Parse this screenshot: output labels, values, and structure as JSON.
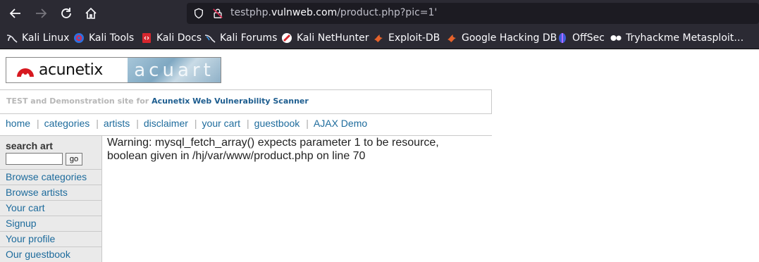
{
  "browser": {
    "url_prefix": "testphp.",
    "url_host": "vulnweb.com",
    "url_path": "/product.php?pic=1'"
  },
  "bookmarks": [
    {
      "label": "Kali Linux",
      "icon": "kali-linux-icon"
    },
    {
      "label": "Kali Tools",
      "icon": "kali-tools-icon"
    },
    {
      "label": "Kali Docs",
      "icon": "kali-docs-icon"
    },
    {
      "label": "Kali Forums",
      "icon": "kali-forums-icon"
    },
    {
      "label": "Kali NetHunter",
      "icon": "kali-nethunter-icon"
    },
    {
      "label": "Exploit-DB",
      "icon": "exploit-db-icon"
    },
    {
      "label": "Google Hacking DB",
      "icon": "google-hacking-db-icon"
    },
    {
      "label": "OffSec",
      "icon": "offsec-icon"
    },
    {
      "label": "Tryhackme Metasploit…",
      "icon": "tryhackme-icon"
    }
  ],
  "site": {
    "logo_left": "acunetix",
    "logo_right": "acuart",
    "tagline_prefix": "TEST and Demonstration site for",
    "tagline_link": "Acunetix Web Vulnerability Scanner"
  },
  "menu": [
    "home",
    "categories",
    "artists",
    "disclaimer",
    "your cart",
    "guestbook",
    "AJAX Demo"
  ],
  "sidebar": {
    "search_title": "search art",
    "search_value": "",
    "go_label": "go",
    "links": [
      "Browse categories",
      "Browse artists",
      "Your cart",
      "Signup",
      "Your profile",
      "Our guestbook"
    ]
  },
  "main": {
    "warning": "Warning: mysql_fetch_array() expects parameter 1 to be resource, boolean given in /hj/var/www/product.php on line 70"
  },
  "colors": {
    "chrome": "#2b2a33",
    "urlbar": "#1c1b22",
    "link": "#1d6b9c",
    "sidebar": "#eaeaea"
  }
}
